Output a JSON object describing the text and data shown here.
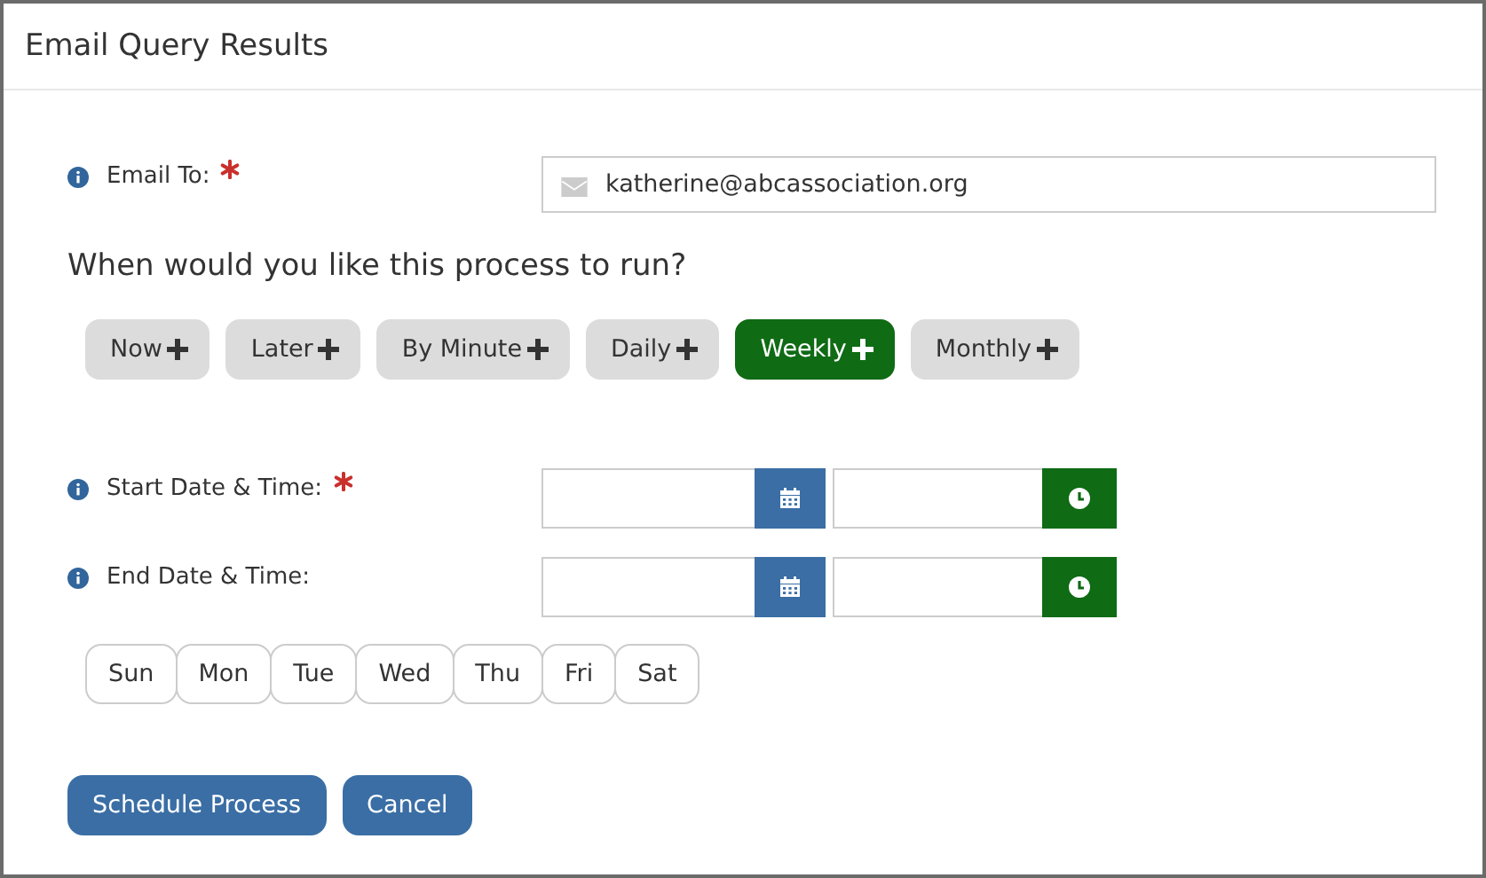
{
  "window": {
    "title": "Email Query Results"
  },
  "email": {
    "label": "Email To:",
    "required": true,
    "value": "katherine@abcassociation.org"
  },
  "question": "When would you like this process to run?",
  "frequencies": [
    {
      "label": "Now",
      "selected": false
    },
    {
      "label": "Later",
      "selected": false
    },
    {
      "label": "By Minute",
      "selected": false
    },
    {
      "label": "Daily",
      "selected": false
    },
    {
      "label": "Weekly",
      "selected": true
    },
    {
      "label": "Monthly",
      "selected": false
    }
  ],
  "date_rows": [
    {
      "label": "Start Date & Time:",
      "required": true
    },
    {
      "label": "End Date & Time:",
      "required": false
    }
  ],
  "days": [
    {
      "label": "Sun",
      "selected": false
    },
    {
      "label": "Mon",
      "selected": false
    },
    {
      "label": "Tue",
      "selected": false
    },
    {
      "label": "Wed",
      "selected": false
    },
    {
      "label": "Thu",
      "selected": false
    },
    {
      "label": "Fri",
      "selected": false
    },
    {
      "label": "Sat",
      "selected": false
    }
  ],
  "buttons": [
    "Schedule Process",
    "Cancel"
  ]
}
